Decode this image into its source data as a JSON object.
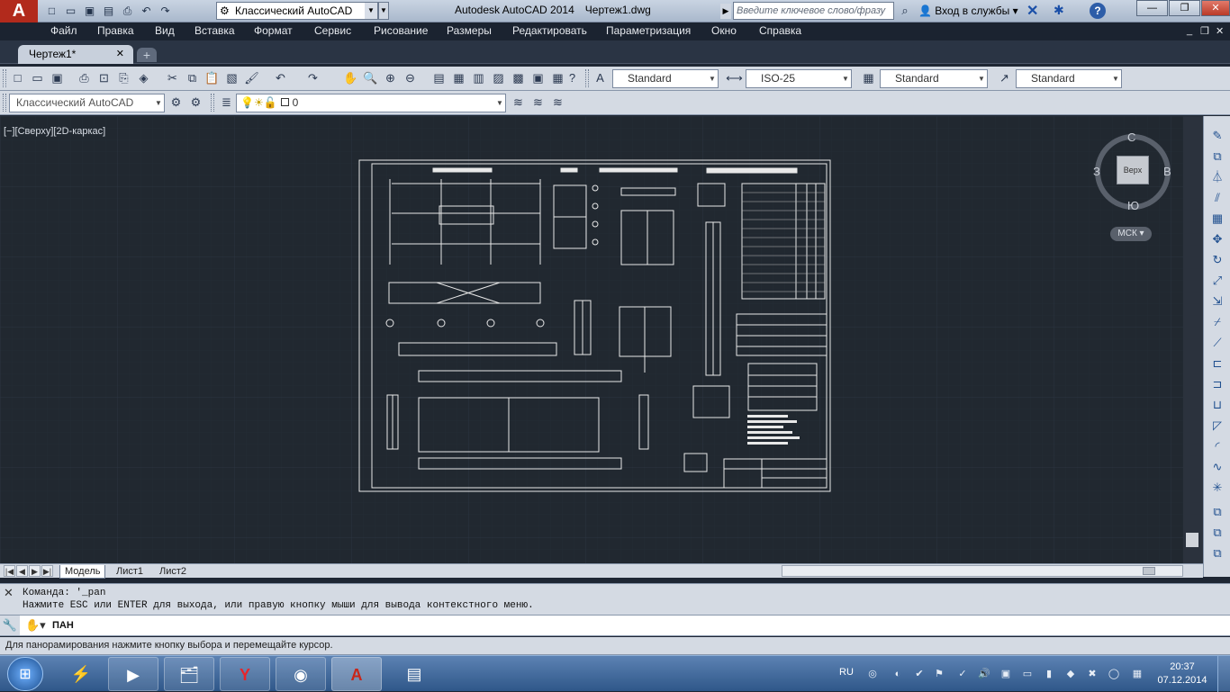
{
  "title_bar": {
    "app_logo": "A",
    "workspace": "Классический AutoCAD",
    "product": "Autodesk AutoCAD 2014",
    "document": "Чертеж1.dwg",
    "search_placeholder": "Введите ключевое слово/фразу",
    "login": "Вход в службы",
    "help": "?"
  },
  "menu": {
    "items": [
      "Файл",
      "Правка",
      "Вид",
      "Вставка",
      "Формат",
      "Сервис",
      "Рисование",
      "Размеры",
      "Редактировать",
      "Параметризация",
      "Окно",
      "Справка"
    ]
  },
  "doc_tabs": {
    "active_tab": "Чертеж1*",
    "new_tab": "+"
  },
  "toolbar": {
    "text_style": "Standard",
    "dim_style": "ISO-25",
    "table_style": "Standard",
    "mleader_style": "Standard",
    "workspace_select": "Классический AutoCAD",
    "layer": "0"
  },
  "viewport": {
    "label": "[−][Сверху][2D-каркас]",
    "viewcube_face": "Верх",
    "compass": {
      "north": "С",
      "south": "Ю",
      "west": "З",
      "east": "В"
    },
    "ucs": "МСК"
  },
  "layout_tabs": {
    "tabs": [
      "Модель",
      "Лист1",
      "Лист2"
    ]
  },
  "command": {
    "history_1": "Команда: '_pan",
    "history_2": "Нажмите ESC или ENTER для выхода, или правую кнопку мыши для вывода контекстного меню.",
    "current": "ПАН"
  },
  "status": {
    "text": "Для панорамирования нажмите кнопку выбора и перемещайте курсор."
  },
  "taskbar": {
    "language": "RU",
    "time": "20:37",
    "date": "07.12.2014"
  }
}
